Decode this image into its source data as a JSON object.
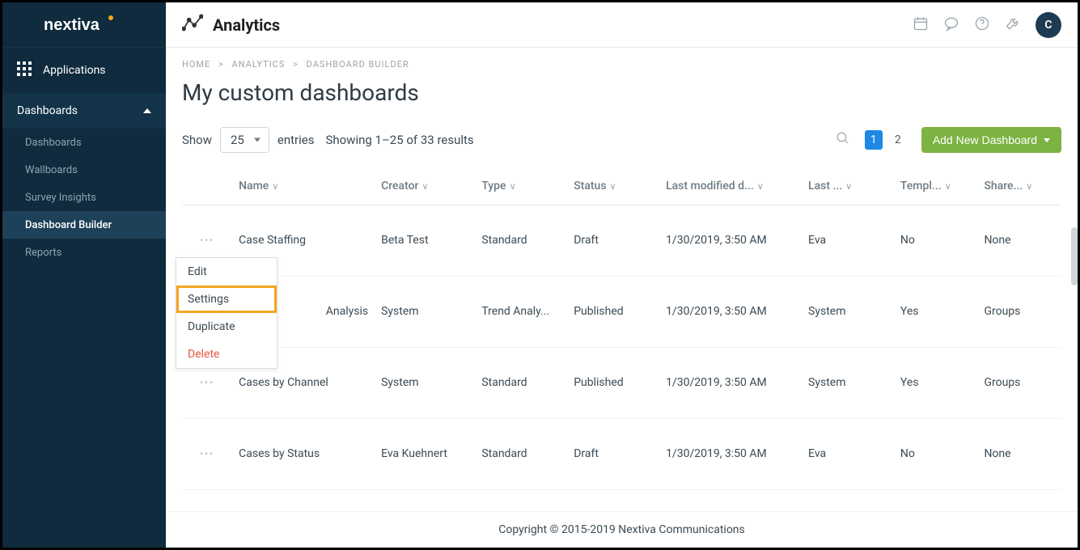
{
  "brand": "nextiva",
  "sidebar": {
    "applications": "Applications",
    "dashboards_section": "Dashboards",
    "items": [
      {
        "label": "Dashboards"
      },
      {
        "label": "Wallboards"
      },
      {
        "label": "Survey Insights"
      },
      {
        "label": "Dashboard Builder"
      },
      {
        "label": "Reports"
      }
    ]
  },
  "header": {
    "title": "Analytics",
    "avatar_initial": "C"
  },
  "breadcrumb": {
    "items": [
      "HOME",
      "ANALYTICS",
      "DASHBOARD BUILDER"
    ]
  },
  "page": {
    "title": "My custom dashboards",
    "show_label": "Show",
    "show_value": "25",
    "entries_label": "entries",
    "results_text": "Showing 1–25 of 33 results",
    "add_button": "Add New Dashboard",
    "pages": [
      "1",
      "2"
    ],
    "current_page": "1"
  },
  "columns": {
    "name": "Name",
    "creator": "Creator",
    "type": "Type",
    "status": "Status",
    "last_modified": "Last modified d...",
    "last_by": "Last ...",
    "template": "Templ...",
    "shared": "Share..."
  },
  "rows": [
    {
      "name": "Case Staffing",
      "creator": "Beta Test",
      "type": "Standard",
      "status": "Draft",
      "modified": "1/30/2019, 3:50 AM",
      "by": "Eva",
      "template": "No",
      "shared": "None"
    },
    {
      "name": "Analysis",
      "creator": "System",
      "type": "Trend Analy...",
      "status": "Published",
      "modified": "1/30/2019, 3:50 AM",
      "by": "System",
      "template": "Yes",
      "shared": "Groups"
    },
    {
      "name": "Cases by Channel",
      "creator": "System",
      "type": "Standard",
      "status": "Published",
      "modified": "1/30/2019, 3:50 AM",
      "by": "System",
      "template": "Yes",
      "shared": "Groups"
    },
    {
      "name": "Cases by Status",
      "creator": "Eva Kuehnert",
      "type": "Standard",
      "status": "Draft",
      "modified": "1/30/2019, 3:50 AM",
      "by": "Eva",
      "template": "No",
      "shared": "None"
    }
  ],
  "context_menu": {
    "edit": "Edit",
    "settings": "Settings",
    "duplicate": "Duplicate",
    "delete": "Delete"
  },
  "footer": "Copyright © 2015-2019 Nextiva Communications"
}
